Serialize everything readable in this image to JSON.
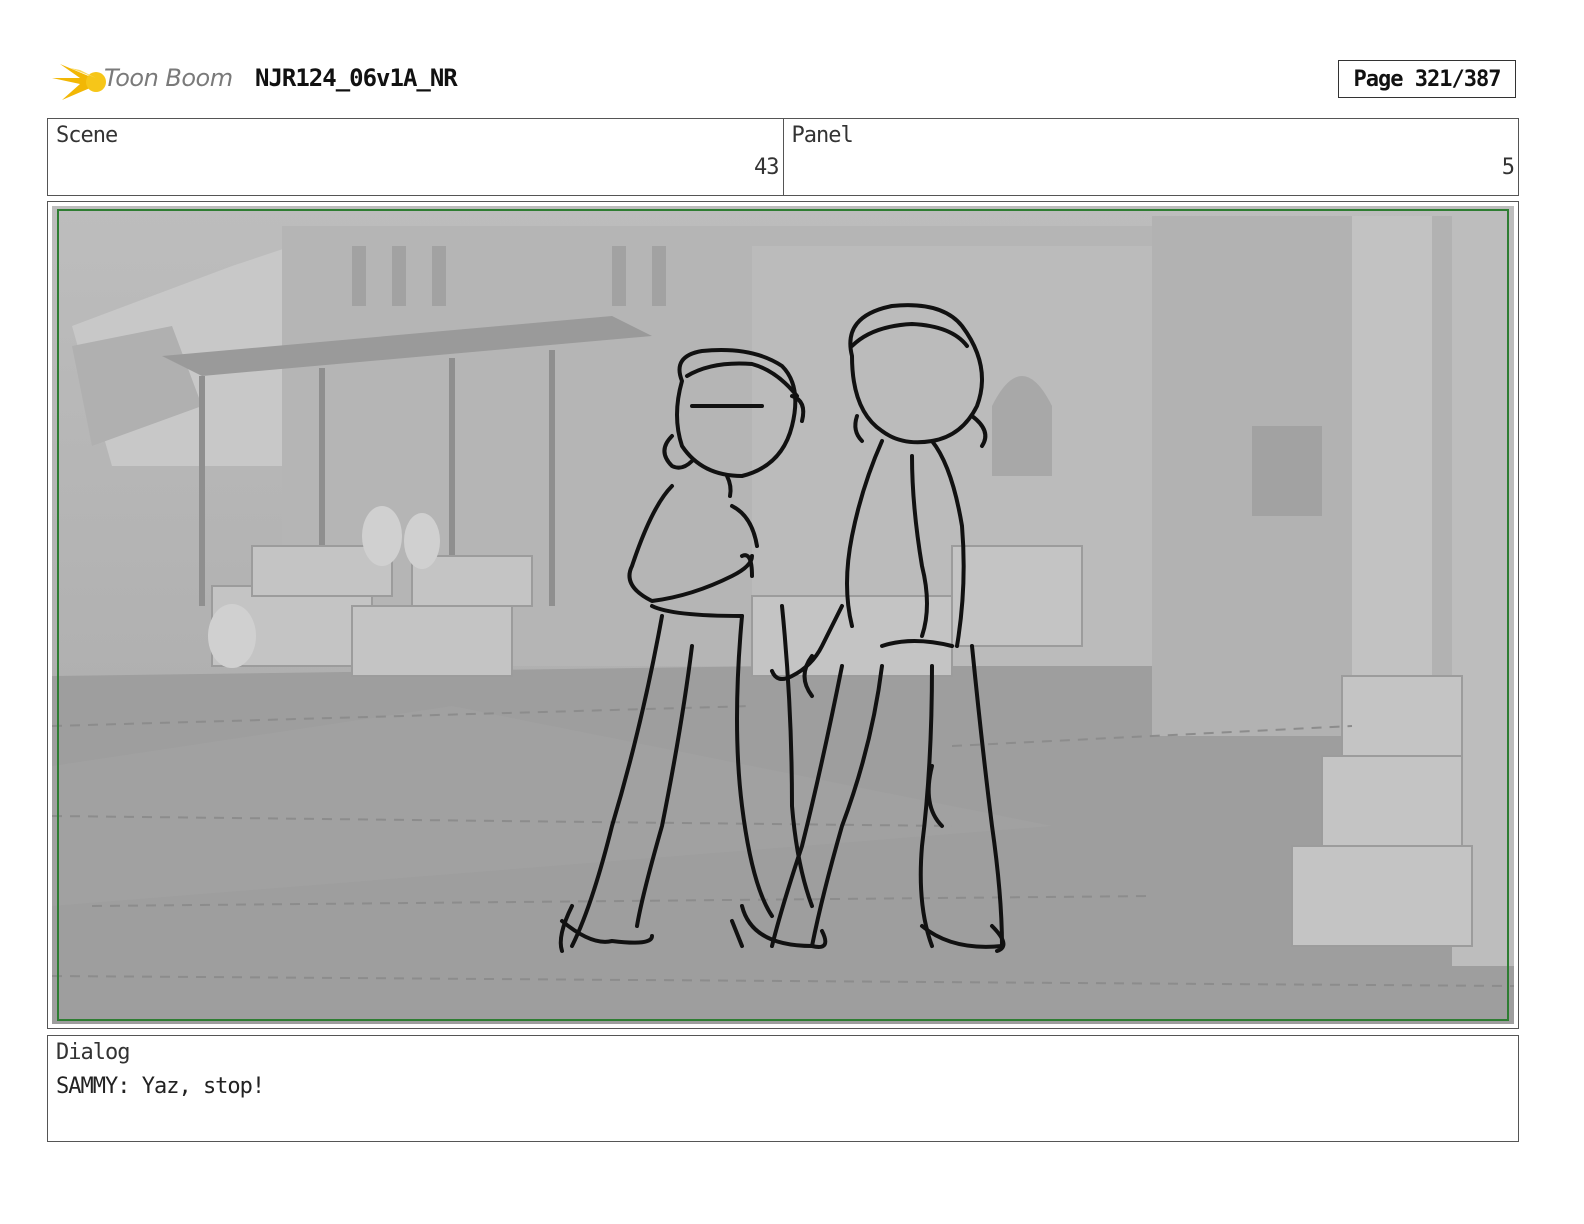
{
  "header": {
    "logo_text": "Toon Boom",
    "document_title": "NJR124_06v1A_NR",
    "page_indicator": "Page 321/387"
  },
  "info": {
    "scene_label": "Scene",
    "scene_value": "43",
    "panel_label": "Panel",
    "panel_value": "5"
  },
  "dialog": {
    "label": "Dialog",
    "text": "SAMMY: Yaz, stop!"
  },
  "colors": {
    "logo_star": "#f2b705",
    "frame_border": "#2e7d32",
    "sketch_bg": "#a9a9a9"
  }
}
